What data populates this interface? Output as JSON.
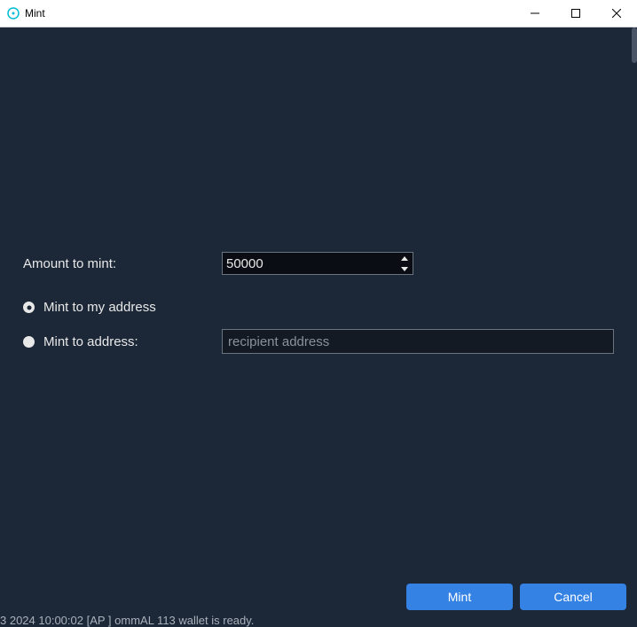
{
  "window": {
    "title": "Mint"
  },
  "form": {
    "amountLabel": "Amount to mint:",
    "amountValue": "50000",
    "mintToMyAddressLabel": "Mint to my address",
    "mintToAddressLabel": "Mint to address:",
    "recipientPlaceholder": "recipient address",
    "recipientValue": ""
  },
  "buttons": {
    "mint": "Mint",
    "cancel": "Cancel"
  },
  "statusBar": "3 2024 10:00:02   [AP ] ommAL   113 wallet is ready."
}
